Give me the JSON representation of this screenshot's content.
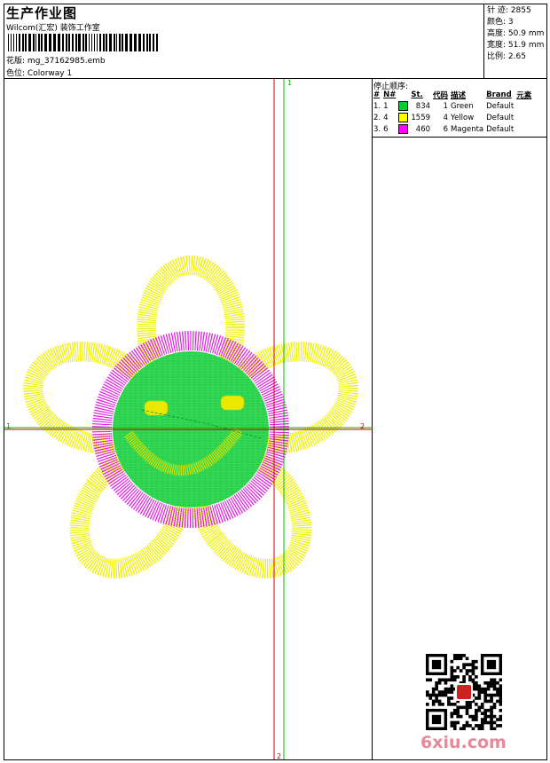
{
  "header": {
    "title": "生产作业图",
    "subtitle": "Wilcom(汇宏)  装饰工作室",
    "design_label": "花版:",
    "design_file": "mg_37162985.emb",
    "colorway_label": "色位:",
    "colorway": "Colorway 1"
  },
  "stats": {
    "stitches_label": "针 迹:",
    "stitches": "2855",
    "colors_label": "颜色:",
    "colors": "3",
    "height_label": "高度:",
    "height": "50.9 mm",
    "width_label": "宽度:",
    "width": "51.9 mm",
    "ratio_label": "比例:",
    "ratio": "2.65"
  },
  "stop_sequence": {
    "title": "停止顺序:",
    "headers": [
      "#",
      "N#",
      "St.",
      "代码",
      "描述",
      "Brand",
      "元素"
    ],
    "rows": [
      {
        "index": "1.",
        "n": "1",
        "color": "#00cc33",
        "st": "834",
        "code": "1",
        "desc": "Green",
        "brand": "Default"
      },
      {
        "index": "2.",
        "n": "4",
        "color": "#ffff00",
        "st": "1559",
        "code": "4",
        "desc": "Yellow",
        "brand": "Default"
      },
      {
        "index": "3.",
        "n": "6",
        "color": "#ff00ff",
        "st": "460",
        "code": "6",
        "desc": "Magenta",
        "brand": "Default"
      }
    ]
  },
  "axes": {
    "top": "1",
    "left": "1",
    "right": "2",
    "bottom": "2"
  },
  "watermark": "6xiu.com",
  "colors": {
    "petal": "#f0f000",
    "ring": "#e020e0",
    "face": "#33dd55",
    "axis_red": "#cc0000",
    "axis_green": "#00bb00"
  }
}
